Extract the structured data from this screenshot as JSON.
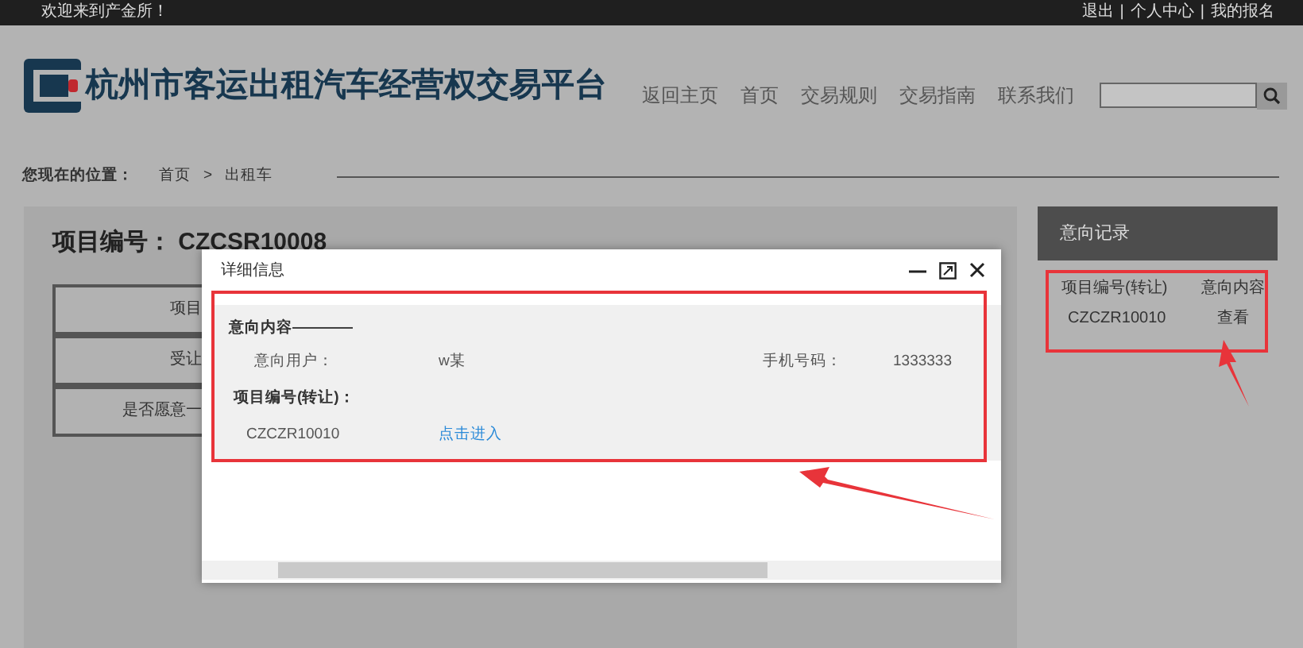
{
  "top_bar": {
    "welcome": "欢迎来到产金所！",
    "links": [
      "退出",
      "个人中心",
      "我的报名"
    ],
    "separator": "|"
  },
  "header": {
    "logo_text": "杭州市客运出租汽车经营权交易平台",
    "nav": [
      "返回主页",
      "首页",
      "交易规则",
      "交易指南",
      "联系我们"
    ]
  },
  "breadcrumb": {
    "label": "您现在的位置：",
    "items": [
      "首页",
      "出租车"
    ],
    "separator": ">"
  },
  "project": {
    "title": "项目编号： CZCSR10008",
    "rows": [
      "项目",
      "受让",
      "是否愿意一"
    ]
  },
  "sidebar": {
    "title": "意向记录",
    "columns": [
      "项目编号(转让)",
      "意向内容"
    ],
    "rows": [
      {
        "cells": [
          "CZCZR10010",
          "查看"
        ]
      }
    ]
  },
  "dialog": {
    "title": "详细信息",
    "section_title": "意向内容————",
    "fields": [
      {
        "label": "意向用户：",
        "value": "w某"
      },
      {
        "label": "手机号码：",
        "value": "1333333"
      }
    ],
    "project_label": "项目编号(转让)：",
    "project_code": "CZCZR10010",
    "link": "点击进入"
  }
}
